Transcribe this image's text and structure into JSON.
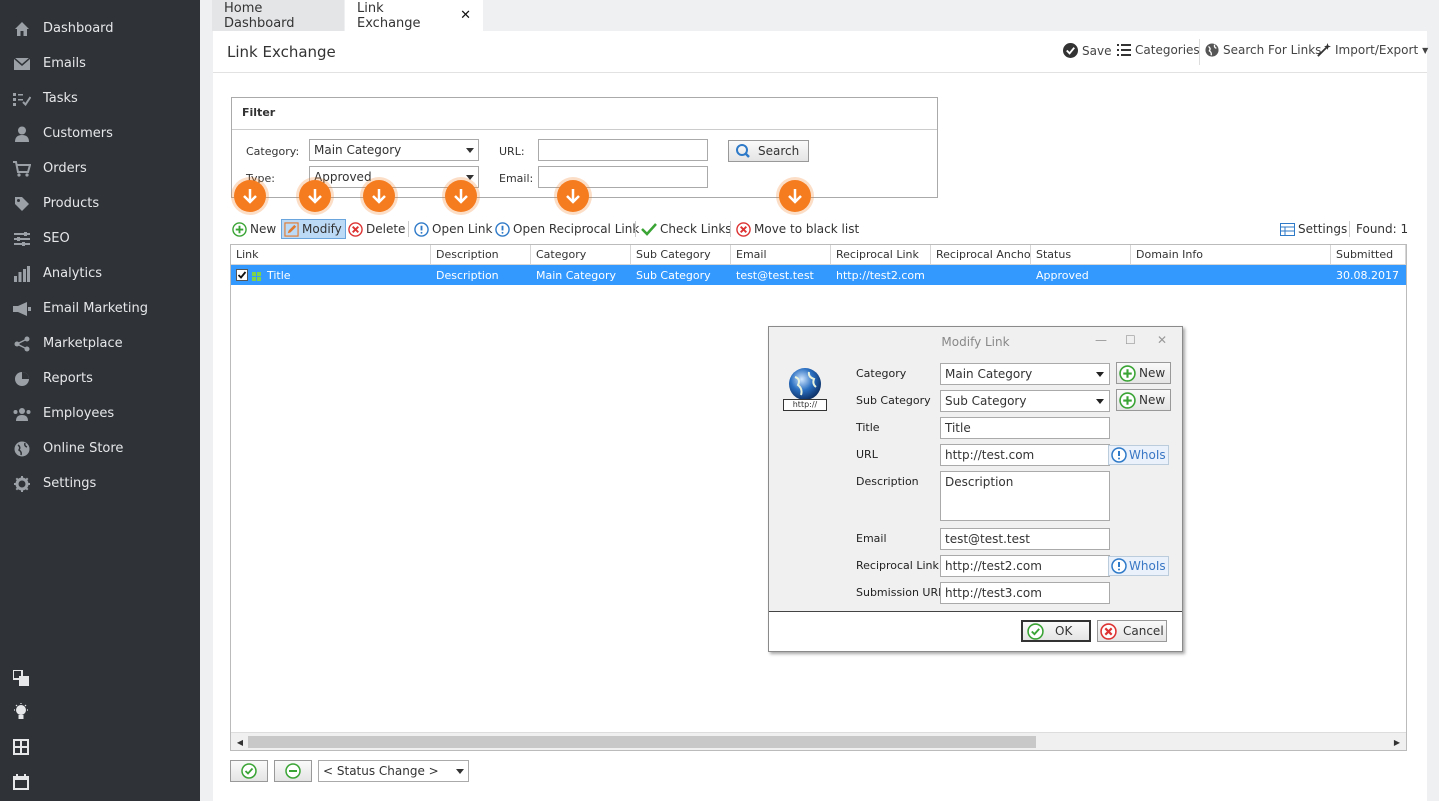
{
  "sidebar": {
    "items": [
      {
        "label": "Dashboard",
        "icon": "home-icon"
      },
      {
        "label": "Emails",
        "icon": "envelope-icon"
      },
      {
        "label": "Tasks",
        "icon": "tasks-icon"
      },
      {
        "label": "Customers",
        "icon": "user-icon"
      },
      {
        "label": "Orders",
        "icon": "cart-icon"
      },
      {
        "label": "Products",
        "icon": "tag-icon"
      },
      {
        "label": "SEO",
        "icon": "sliders-icon"
      },
      {
        "label": "Analytics",
        "icon": "bar-chart-icon"
      },
      {
        "label": "Email Marketing",
        "icon": "megaphone-icon"
      },
      {
        "label": "Marketplace",
        "icon": "share-icon"
      },
      {
        "label": "Reports",
        "icon": "pie-chart-icon"
      },
      {
        "label": "Employees",
        "icon": "users-icon"
      },
      {
        "label": "Online Store",
        "icon": "globe-icon"
      },
      {
        "label": "Settings",
        "icon": "gear-icon"
      }
    ]
  },
  "tabs": [
    {
      "label": "Home Dashboard"
    },
    {
      "label": "Link Exchange"
    }
  ],
  "header": {
    "title": "Link Exchange",
    "save": "Save",
    "categories": "Categories",
    "search_links": "Search For Links",
    "import_export": "Import/Export"
  },
  "filter": {
    "title": "Filter",
    "category_label": "Category:",
    "category_value": "Main Category",
    "type_label": "Type:",
    "type_value": "Approved",
    "url_label": "URL:",
    "url_value": "",
    "email_label": "Email:",
    "email_value": "",
    "search": "Search"
  },
  "toolbar": {
    "new": "New",
    "modify": "Modify",
    "delete": "Delete",
    "open_link": "Open Link",
    "open_reciprocal": "Open Reciprocal Link",
    "check_links": "Check Links",
    "blacklist": "Move to black list",
    "settings": "Settings",
    "found": "Found: 1"
  },
  "grid": {
    "columns": [
      "Link",
      "Description",
      "Category",
      "Sub Category",
      "Email",
      "Reciprocal Link",
      "Reciprocal Ancho",
      "Status",
      "Domain Info",
      "Submitted"
    ],
    "rows": [
      [
        "Title",
        "Description",
        "Main Category",
        "Sub Category",
        "test@test.test",
        "http://test2.com",
        "",
        "Approved",
        "",
        "30.08.2017"
      ]
    ]
  },
  "dialog": {
    "title": "Modify Link",
    "icon_caption": "http://",
    "category_label": "Category",
    "category_value": "Main Category",
    "subcategory_label": "Sub Category",
    "subcategory_value": "Sub Category",
    "new": "New",
    "title_label": "Title",
    "title_value": "Title",
    "url_label": "URL",
    "url_value": "http://test.com",
    "whois": "WhoIs",
    "description_label": "Description",
    "description_value": "Description",
    "email_label": "Email",
    "email_value": "test@test.test",
    "reciprocal_label": "Reciprocal Link",
    "reciprocal_value": "http://test2.com",
    "submission_label": "Submission URL",
    "submission_value": "http://test3.com",
    "ok": "OK",
    "cancel": "Cancel"
  },
  "bottom": {
    "status_change": "< Status Change >"
  },
  "colors": {
    "sidebar_bg": "#2f3338",
    "accent_orange": "#f57c1f",
    "selection": "#3399ff"
  }
}
